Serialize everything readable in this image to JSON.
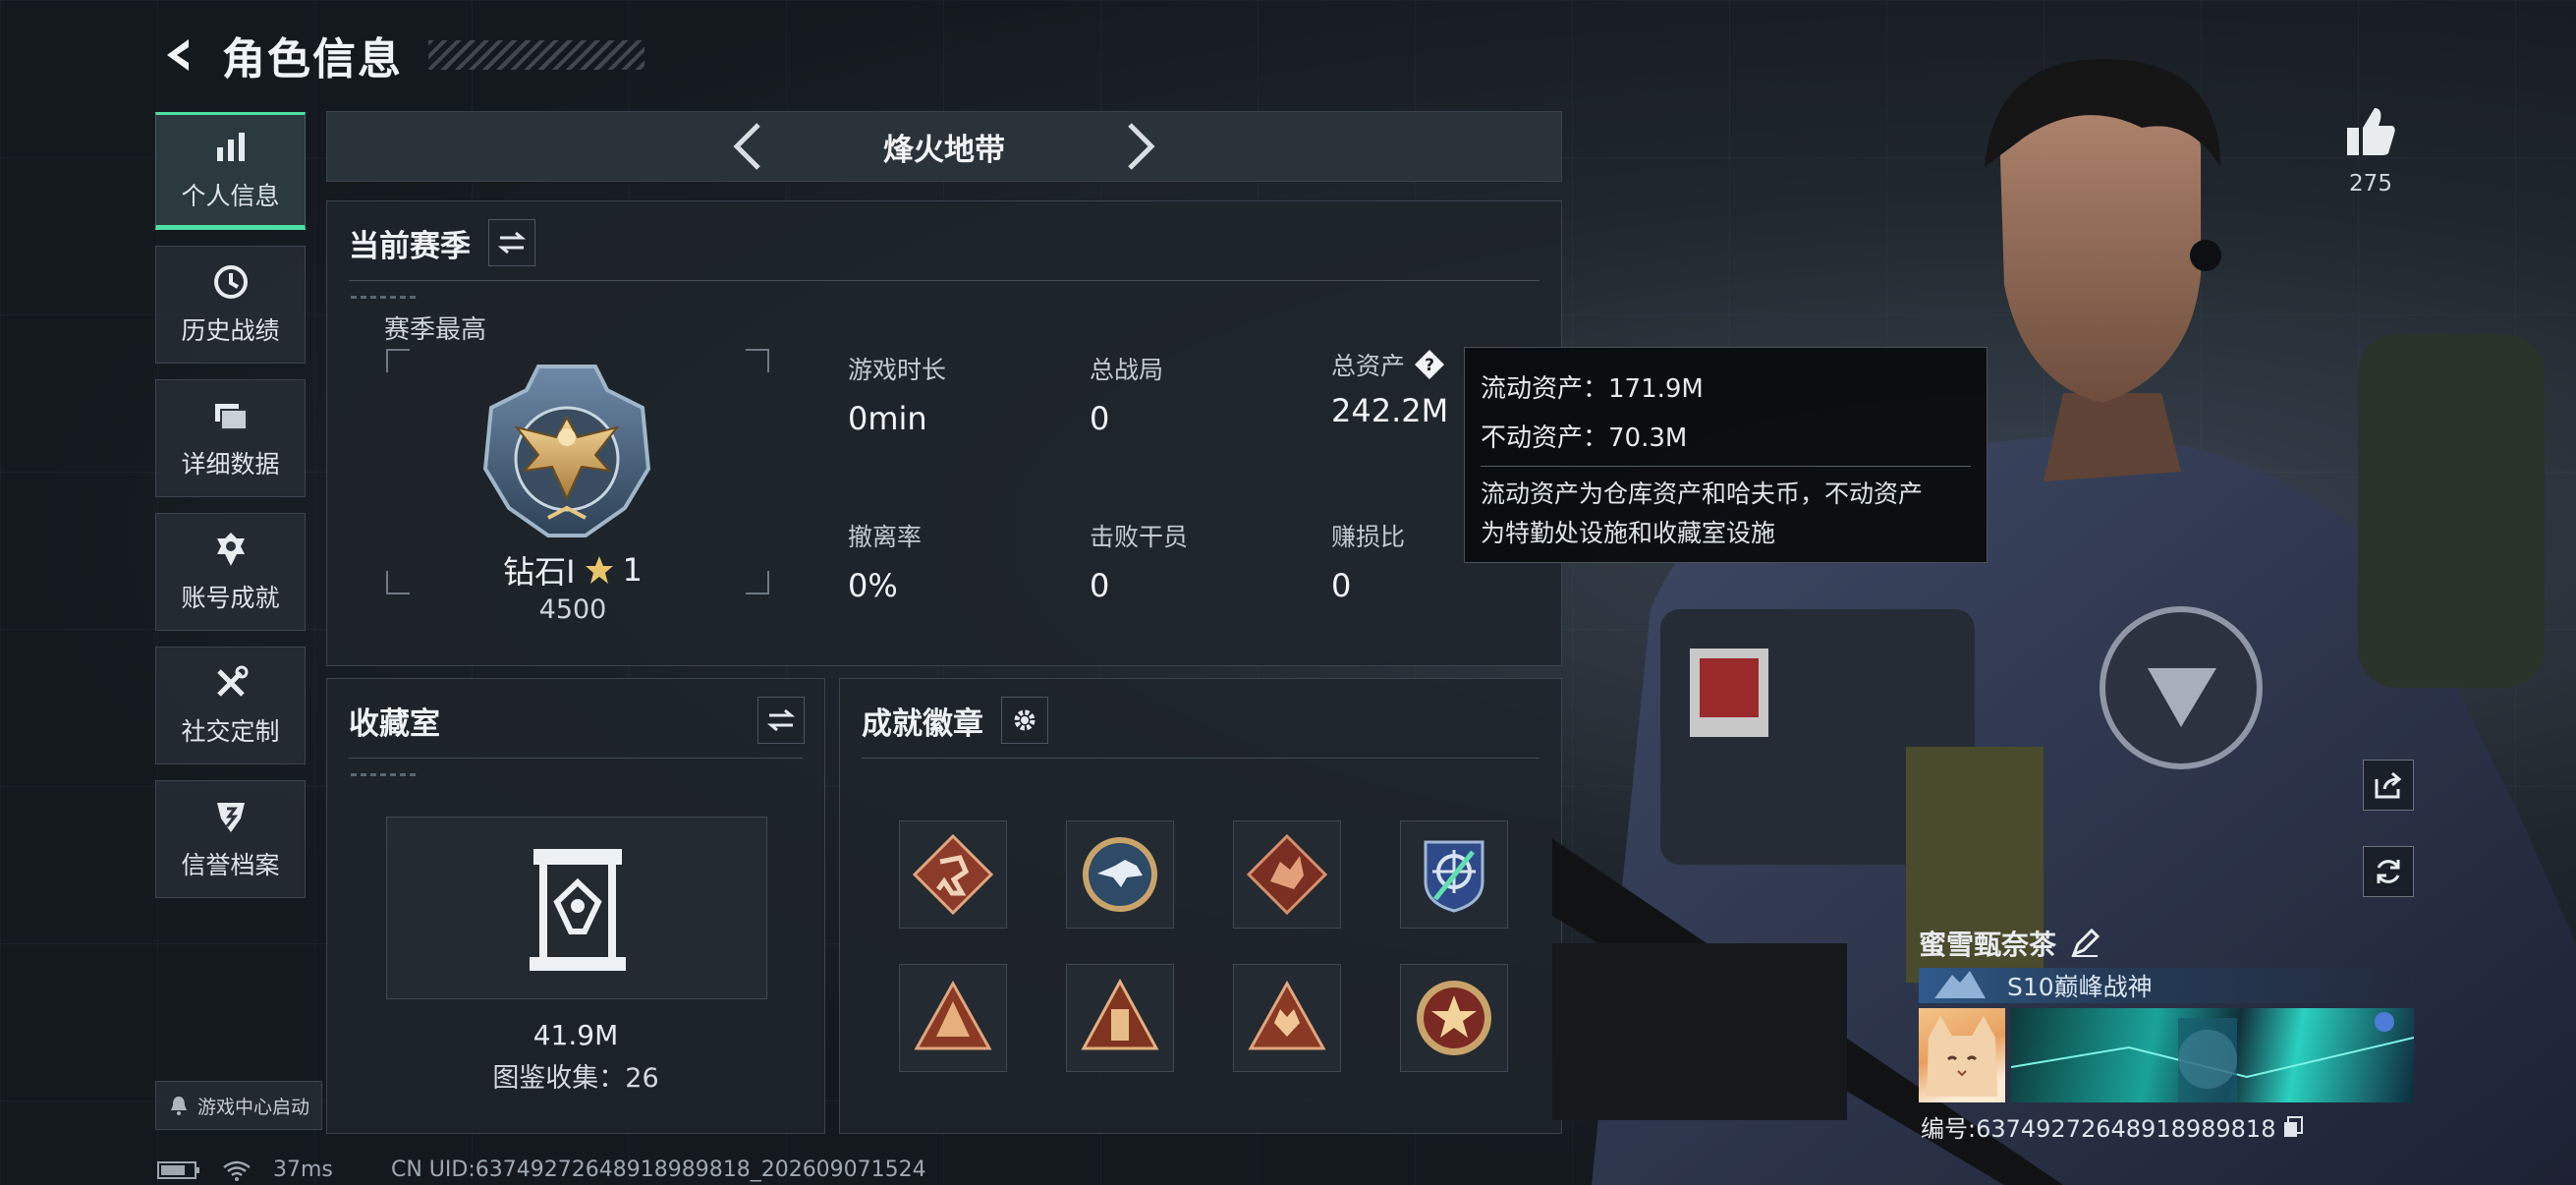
{
  "header": {
    "title": "角色信息"
  },
  "sidebar": {
    "items": [
      {
        "label": "个人信息",
        "icon": "bar-chart-icon"
      },
      {
        "label": "历史战绩",
        "icon": "history-icon"
      },
      {
        "label": "详细数据",
        "icon": "folder-icon"
      },
      {
        "label": "账号成就",
        "icon": "achievement-icon"
      },
      {
        "label": "社交定制",
        "icon": "tools-icon"
      },
      {
        "label": "信誉档案",
        "icon": "credit-icon"
      }
    ],
    "launch_label": "游戏中心启动"
  },
  "mode": {
    "name": "烽火地带"
  },
  "season": {
    "title": "当前赛季",
    "best_label": "赛季最高",
    "rank": "钻石Ⅰ",
    "rank_stars": "1",
    "rank_score": "4500",
    "stats": [
      {
        "label": "游戏时长",
        "value": "0min"
      },
      {
        "label": "总战局",
        "value": "0"
      },
      {
        "label": "总资产",
        "value": "242.2M"
      },
      {
        "label": "撤离率",
        "value": "0%"
      },
      {
        "label": "击败干员",
        "value": "0"
      },
      {
        "label": "赚损比",
        "value": "0"
      }
    ]
  },
  "tooltip": {
    "liquid": "流动资产：171.9M",
    "fixed": "不动资产：70.3M",
    "desc_line1": "流动资产为仓库资产和哈夫币，不动资产",
    "desc_line2": "为特勤处设施和收藏室设施"
  },
  "vault": {
    "title": "收藏室",
    "value": "41.9M",
    "collection": "图鉴收集：26"
  },
  "achievements": {
    "title": "成就徽章"
  },
  "likes": {
    "count": "275"
  },
  "player": {
    "name": "蜜雪甄奈茶",
    "title": "S10巅峰战神",
    "uid_line": "编号:6374927264891898981​8"
  },
  "status": {
    "ping": "37ms",
    "cn_uid": "CN UID:63749272648918989818_202609071524"
  },
  "colors": {
    "accent": "#4fe0a8",
    "panel_bg": "#1e242a",
    "tooltip_bg": "#0a0c0e"
  }
}
